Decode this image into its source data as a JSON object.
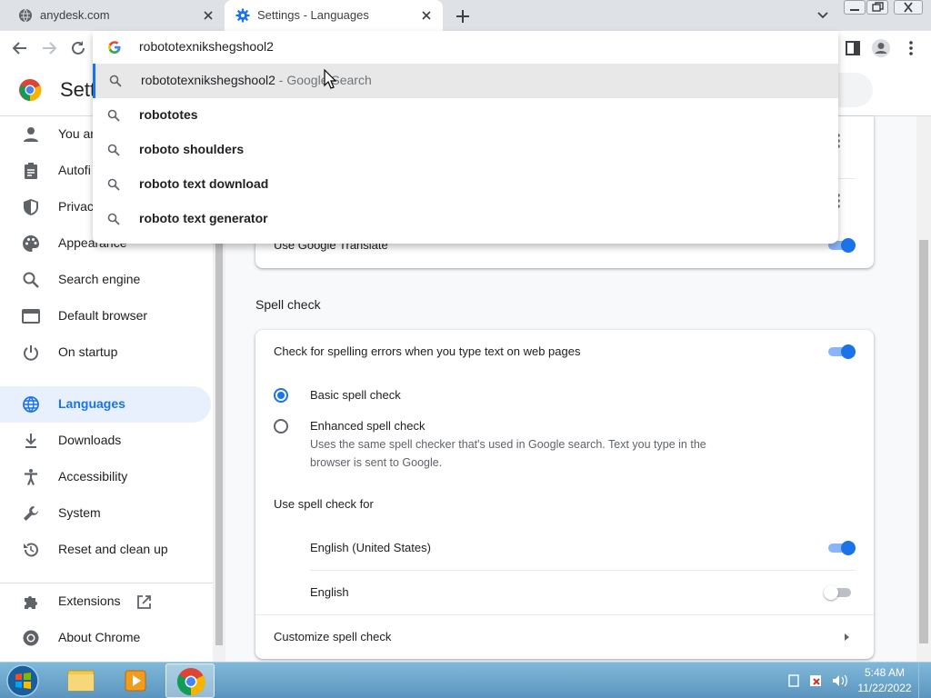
{
  "browser": {
    "tabs": [
      {
        "title": "anydesk.com",
        "icon": "globe-icon"
      },
      {
        "title": "Settings - Languages",
        "icon": "gear-icon"
      }
    ],
    "omnibox": {
      "input_value": "robototexnikshegshool2",
      "suggestions": [
        {
          "text": "robototexnikshegshool2",
          "desc": " - Google Search",
          "bold": false
        },
        {
          "text": "robototes",
          "desc": "",
          "bold": true
        },
        {
          "text": "roboto shoulders",
          "desc": "",
          "bold": true
        },
        {
          "text": "roboto text download",
          "desc": "",
          "bold": true
        },
        {
          "text": "roboto text generator",
          "desc": "",
          "bold": true
        }
      ]
    }
  },
  "settings": {
    "title": "Settings",
    "sidebar": {
      "items": [
        {
          "label": "You and Google",
          "icon": "person-icon"
        },
        {
          "label": "Autofill",
          "icon": "clipboard-icon"
        },
        {
          "label": "Privacy and security",
          "icon": "shield-icon"
        },
        {
          "label": "Appearance",
          "icon": "palette-icon"
        },
        {
          "label": "Search engine",
          "icon": "search-icon"
        },
        {
          "label": "Default browser",
          "icon": "browser-icon"
        },
        {
          "label": "On startup",
          "icon": "power-icon"
        },
        {
          "label": "Languages",
          "icon": "globe-icon"
        },
        {
          "label": "Downloads",
          "icon": "download-icon"
        },
        {
          "label": "Accessibility",
          "icon": "accessibility-icon"
        },
        {
          "label": "System",
          "icon": "wrench-icon"
        },
        {
          "label": "Reset and clean up",
          "icon": "reset-icon"
        },
        {
          "label": "Extensions",
          "icon": "puzzle-icon"
        },
        {
          "label": "About Chrome",
          "icon": "chrome-icon"
        }
      ],
      "visible_labels": [
        "You ar",
        "Autofi",
        "Privac",
        "Appearance"
      ]
    },
    "translate": {
      "label": "Use Google Translate",
      "enabled": true
    },
    "spell_check": {
      "heading": "Spell check",
      "check_label": "Check for spelling errors when you type text on web pages",
      "check_enabled": true,
      "basic_label": "Basic spell check",
      "enhanced_label": "Enhanced spell check",
      "enhanced_desc_1": "Uses the same spell checker that's used in Google search. Text you type in the",
      "enhanced_desc_2": "browser is sent to Google.",
      "selected": "basic",
      "use_for_label": "Use spell check for",
      "languages": [
        {
          "name": "English (United States)",
          "enabled": true
        },
        {
          "name": "English",
          "enabled": false
        }
      ],
      "customize_label": "Customize spell check"
    }
  },
  "taskbar": {
    "time": "5:48 AM",
    "date": "11/22/2022"
  },
  "colors": {
    "accent": "#1a73e8",
    "active_nav_bg": "#e8f0fe"
  }
}
